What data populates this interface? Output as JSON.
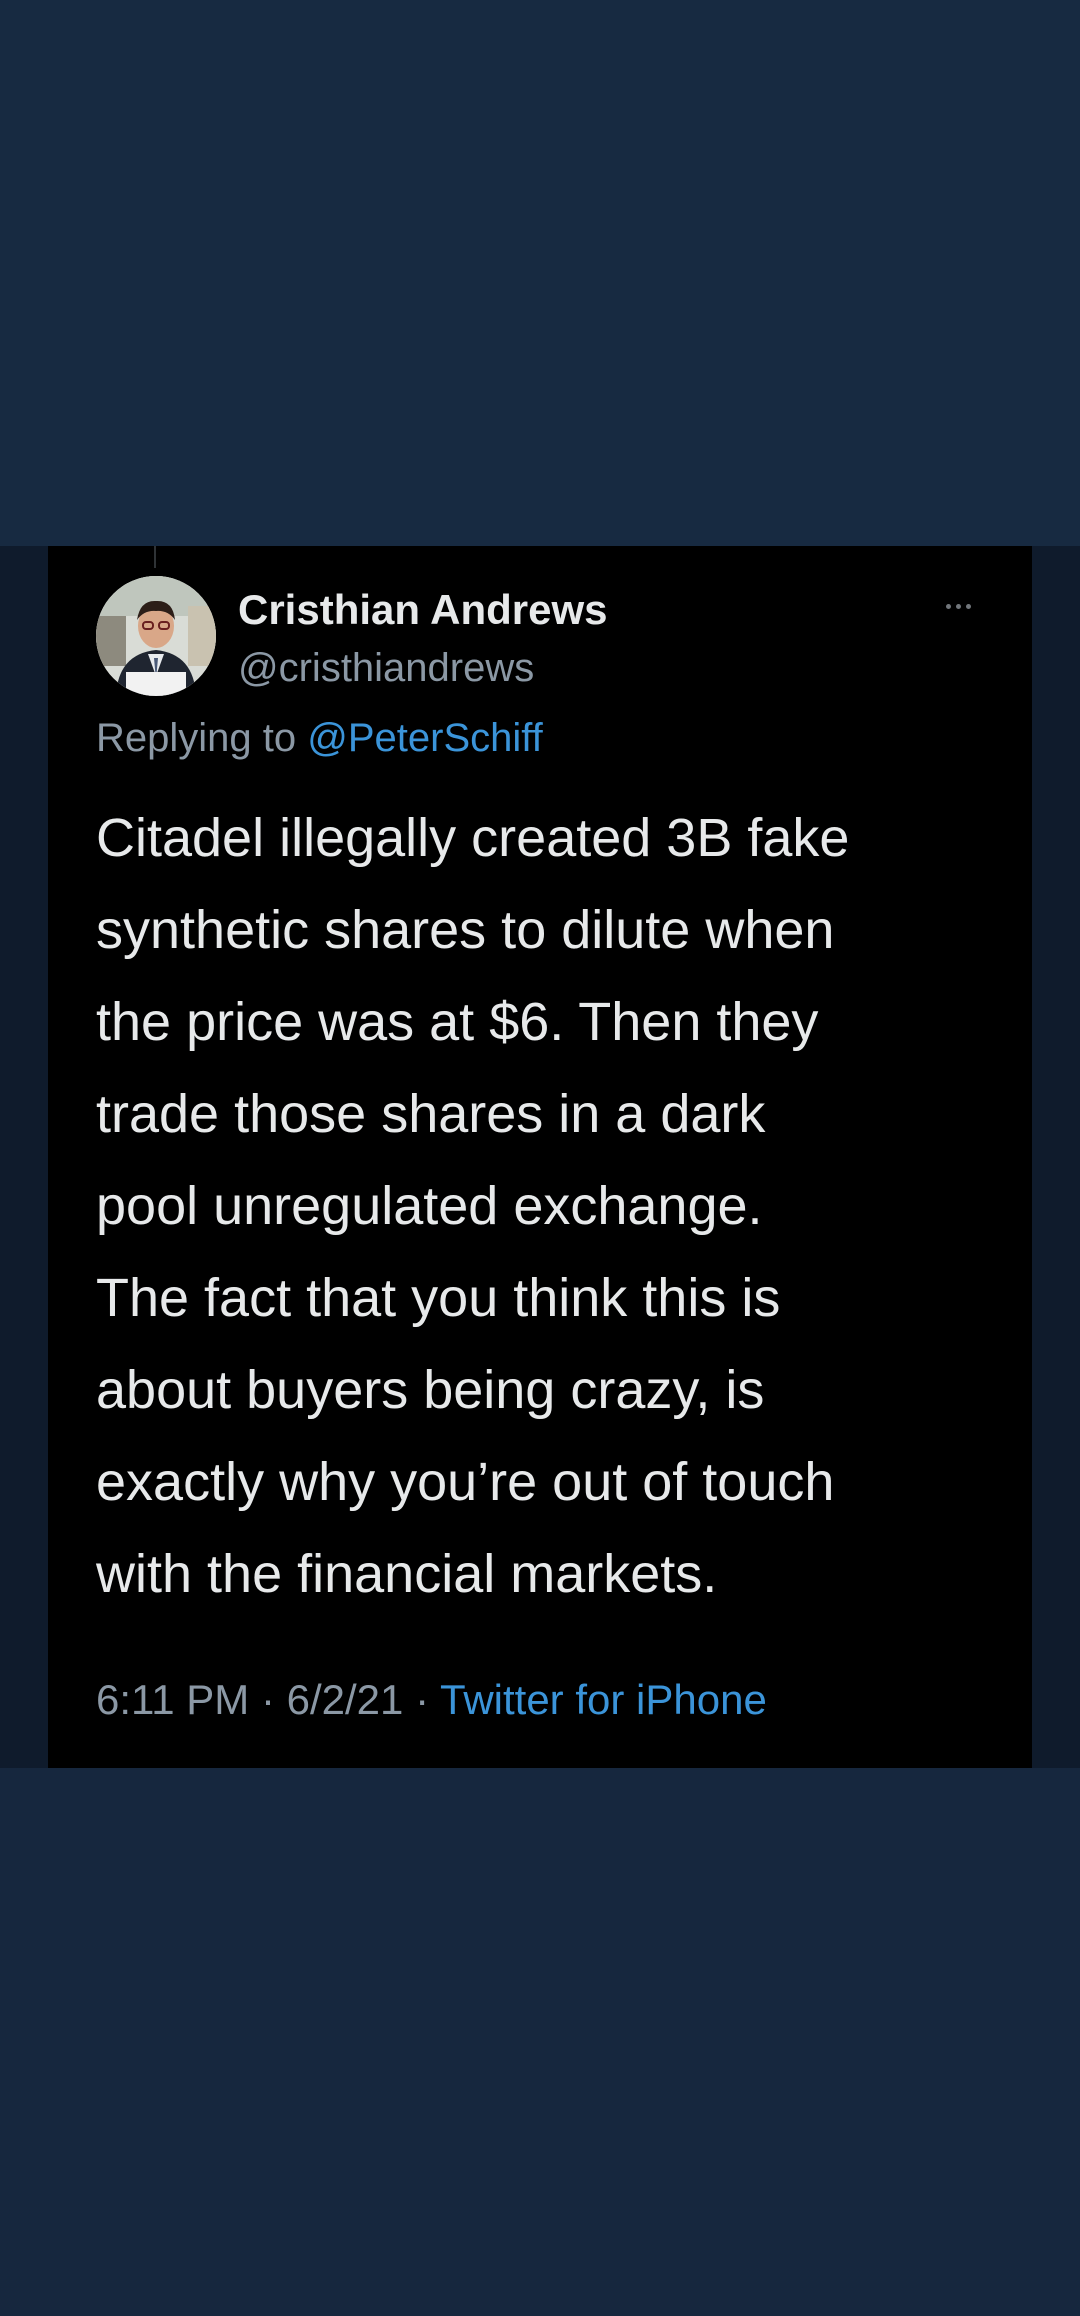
{
  "tweet": {
    "author": {
      "display_name": "Cristhian Andrews",
      "handle": "@cristhiandrews"
    },
    "replying_to_prefix": "Replying to ",
    "replying_to": "@PeterSchiff",
    "text_lines": [
      "Citadel illegally created 3B fake",
      "synthetic shares to dilute when",
      "the price was at $6. Then they",
      "trade those shares in a dark",
      "pool unregulated exchange.",
      "The fact that you think this is",
      "about buyers being crazy, is",
      "exactly why you’re out of touch",
      "with the financial markets."
    ],
    "time": "6:11 PM",
    "separator": " · ",
    "date": "6/2/21",
    "source": "Twitter for iPhone"
  },
  "icons": {
    "more": "more-horizontal-icon",
    "avatar": "profile-photo"
  },
  "colors": {
    "page_background": "#16283f",
    "card_background": "#000000",
    "primary_text": "#e7e9ea",
    "secondary_text": "#8b98a5",
    "link": "#3b94d9"
  }
}
